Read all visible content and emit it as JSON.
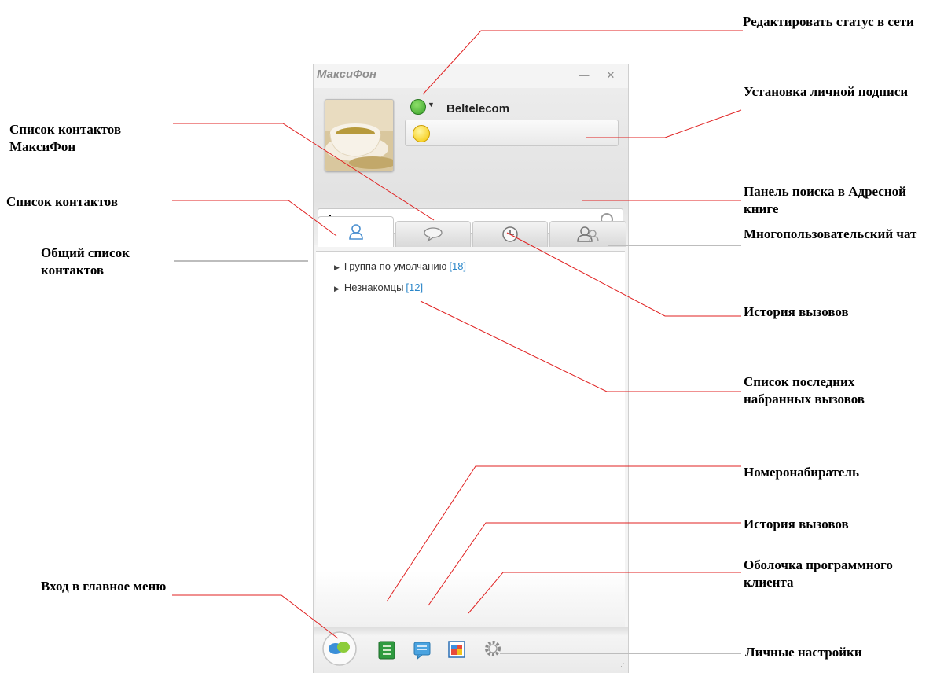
{
  "app": {
    "title": "МаксиФон",
    "minimize": "—",
    "close": "✕",
    "account_name": "Beltelecom",
    "signature_value": "",
    "search_value": "",
    "groups": [
      {
        "label": "Группа по умолчанию",
        "count": "[18]"
      },
      {
        "label": "Незнакомцы",
        "count": "[12]"
      }
    ]
  },
  "callouts": {
    "edit_status": "Редактировать статус в сети",
    "personal_signature": "Установка личной подписи",
    "maxifon_contacts": "Список контактов МаксиФон",
    "contact_list": "Список контактов",
    "general_contacts": "Общий список контактов",
    "address_book_search": "Панель поиска в Адресной книге",
    "multiuser_chat": "Многопользовательский чат",
    "call_history_tab": "История вызовов",
    "recent_calls": "Список последних набранных вызовов",
    "dialer": "Номеронабиратель",
    "call_history_button": "История вызовов",
    "client_skin": "Оболочка программного клиента",
    "main_menu": "Вход в главное меню",
    "personal_settings": "Личные настройки"
  }
}
